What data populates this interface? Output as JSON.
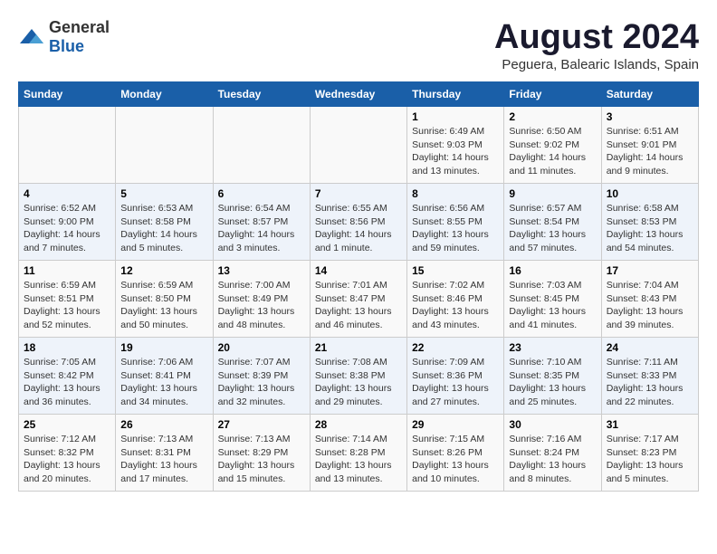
{
  "header": {
    "logo_general": "General",
    "logo_blue": "Blue",
    "title": "August 2024",
    "subtitle": "Peguera, Balearic Islands, Spain"
  },
  "columns": [
    "Sunday",
    "Monday",
    "Tuesday",
    "Wednesday",
    "Thursday",
    "Friday",
    "Saturday"
  ],
  "weeks": [
    {
      "days": [
        {
          "num": "",
          "detail": ""
        },
        {
          "num": "",
          "detail": ""
        },
        {
          "num": "",
          "detail": ""
        },
        {
          "num": "",
          "detail": ""
        },
        {
          "num": "1",
          "detail": "Sunrise: 6:49 AM\nSunset: 9:03 PM\nDaylight: 14 hours\nand 13 minutes."
        },
        {
          "num": "2",
          "detail": "Sunrise: 6:50 AM\nSunset: 9:02 PM\nDaylight: 14 hours\nand 11 minutes."
        },
        {
          "num": "3",
          "detail": "Sunrise: 6:51 AM\nSunset: 9:01 PM\nDaylight: 14 hours\nand 9 minutes."
        }
      ]
    },
    {
      "days": [
        {
          "num": "4",
          "detail": "Sunrise: 6:52 AM\nSunset: 9:00 PM\nDaylight: 14 hours\nand 7 minutes."
        },
        {
          "num": "5",
          "detail": "Sunrise: 6:53 AM\nSunset: 8:58 PM\nDaylight: 14 hours\nand 5 minutes."
        },
        {
          "num": "6",
          "detail": "Sunrise: 6:54 AM\nSunset: 8:57 PM\nDaylight: 14 hours\nand 3 minutes."
        },
        {
          "num": "7",
          "detail": "Sunrise: 6:55 AM\nSunset: 8:56 PM\nDaylight: 14 hours\nand 1 minute."
        },
        {
          "num": "8",
          "detail": "Sunrise: 6:56 AM\nSunset: 8:55 PM\nDaylight: 13 hours\nand 59 minutes."
        },
        {
          "num": "9",
          "detail": "Sunrise: 6:57 AM\nSunset: 8:54 PM\nDaylight: 13 hours\nand 57 minutes."
        },
        {
          "num": "10",
          "detail": "Sunrise: 6:58 AM\nSunset: 8:53 PM\nDaylight: 13 hours\nand 54 minutes."
        }
      ]
    },
    {
      "days": [
        {
          "num": "11",
          "detail": "Sunrise: 6:59 AM\nSunset: 8:51 PM\nDaylight: 13 hours\nand 52 minutes."
        },
        {
          "num": "12",
          "detail": "Sunrise: 6:59 AM\nSunset: 8:50 PM\nDaylight: 13 hours\nand 50 minutes."
        },
        {
          "num": "13",
          "detail": "Sunrise: 7:00 AM\nSunset: 8:49 PM\nDaylight: 13 hours\nand 48 minutes."
        },
        {
          "num": "14",
          "detail": "Sunrise: 7:01 AM\nSunset: 8:47 PM\nDaylight: 13 hours\nand 46 minutes."
        },
        {
          "num": "15",
          "detail": "Sunrise: 7:02 AM\nSunset: 8:46 PM\nDaylight: 13 hours\nand 43 minutes."
        },
        {
          "num": "16",
          "detail": "Sunrise: 7:03 AM\nSunset: 8:45 PM\nDaylight: 13 hours\nand 41 minutes."
        },
        {
          "num": "17",
          "detail": "Sunrise: 7:04 AM\nSunset: 8:43 PM\nDaylight: 13 hours\nand 39 minutes."
        }
      ]
    },
    {
      "days": [
        {
          "num": "18",
          "detail": "Sunrise: 7:05 AM\nSunset: 8:42 PM\nDaylight: 13 hours\nand 36 minutes."
        },
        {
          "num": "19",
          "detail": "Sunrise: 7:06 AM\nSunset: 8:41 PM\nDaylight: 13 hours\nand 34 minutes."
        },
        {
          "num": "20",
          "detail": "Sunrise: 7:07 AM\nSunset: 8:39 PM\nDaylight: 13 hours\nand 32 minutes."
        },
        {
          "num": "21",
          "detail": "Sunrise: 7:08 AM\nSunset: 8:38 PM\nDaylight: 13 hours\nand 29 minutes."
        },
        {
          "num": "22",
          "detail": "Sunrise: 7:09 AM\nSunset: 8:36 PM\nDaylight: 13 hours\nand 27 minutes."
        },
        {
          "num": "23",
          "detail": "Sunrise: 7:10 AM\nSunset: 8:35 PM\nDaylight: 13 hours\nand 25 minutes."
        },
        {
          "num": "24",
          "detail": "Sunrise: 7:11 AM\nSunset: 8:33 PM\nDaylight: 13 hours\nand 22 minutes."
        }
      ]
    },
    {
      "days": [
        {
          "num": "25",
          "detail": "Sunrise: 7:12 AM\nSunset: 8:32 PM\nDaylight: 13 hours\nand 20 minutes."
        },
        {
          "num": "26",
          "detail": "Sunrise: 7:13 AM\nSunset: 8:31 PM\nDaylight: 13 hours\nand 17 minutes."
        },
        {
          "num": "27",
          "detail": "Sunrise: 7:13 AM\nSunset: 8:29 PM\nDaylight: 13 hours\nand 15 minutes."
        },
        {
          "num": "28",
          "detail": "Sunrise: 7:14 AM\nSunset: 8:28 PM\nDaylight: 13 hours\nand 13 minutes."
        },
        {
          "num": "29",
          "detail": "Sunrise: 7:15 AM\nSunset: 8:26 PM\nDaylight: 13 hours\nand 10 minutes."
        },
        {
          "num": "30",
          "detail": "Sunrise: 7:16 AM\nSunset: 8:24 PM\nDaylight: 13 hours\nand 8 minutes."
        },
        {
          "num": "31",
          "detail": "Sunrise: 7:17 AM\nSunset: 8:23 PM\nDaylight: 13 hours\nand 5 minutes."
        }
      ]
    }
  ]
}
